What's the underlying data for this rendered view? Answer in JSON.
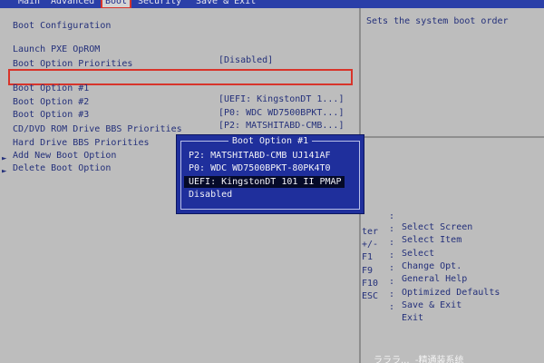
{
  "menu": {
    "items": [
      {
        "label": "Main",
        "active": false
      },
      {
        "label": "Advanced",
        "active": false
      },
      {
        "label": "Boot",
        "active": true
      },
      {
        "label": "Security",
        "active": false
      },
      {
        "label": "Save & Exit",
        "active": false
      }
    ]
  },
  "boot": {
    "section_config": "Boot Configuration",
    "pxe_label": "Launch PXE OpROM",
    "pxe_value": "[Disabled]",
    "section_priorities": "Boot Option Priorities",
    "options": [
      {
        "label": "Boot Option #1",
        "value": "[UEFI: KingstonDT 1...]"
      },
      {
        "label": "Boot Option #2",
        "value": "[P0: WDC WD7500BPKT...]"
      },
      {
        "label": "Boot Option #3",
        "value": "[P2: MATSHITABD-CMB...]"
      }
    ],
    "links": [
      "CD/DVD ROM Drive BBS Priorities",
      "Hard Drive BBS Priorities",
      "Add New Boot Option",
      "Delete Boot Option"
    ]
  },
  "popup": {
    "title": "Boot Option #1",
    "options": [
      "P2: MATSHITABD-CMB UJ141AF",
      "P0: WDC WD7500BPKT-80PK4T0",
      "UEFI: KingstonDT 101 II PMAP",
      "Disabled"
    ],
    "selected_index": 2
  },
  "help": {
    "description": "Sets the system boot order",
    "keys": [
      {
        "key": "",
        "desc": "Select Screen"
      },
      {
        "key": "",
        "desc": "Select Item"
      },
      {
        "key": "ter",
        "desc": "Select"
      },
      {
        "key": "+/-",
        "desc": "Change Opt."
      },
      {
        "key": "F1",
        "desc": "General Help"
      },
      {
        "key": "F9",
        "desc": "Optimized Defaults"
      },
      {
        "key": "F10",
        "desc": "Save & Exit"
      },
      {
        "key": "ESC",
        "desc": "Exit"
      }
    ],
    "separator": ":"
  },
  "watermark": "ラララ...  -精通装系统",
  "colors": {
    "menubar": "#2a3fa8",
    "panel": "#bdbdbd",
    "text": "#24307a",
    "popup": "#1f2f9c",
    "highlight": "#d8342a"
  }
}
